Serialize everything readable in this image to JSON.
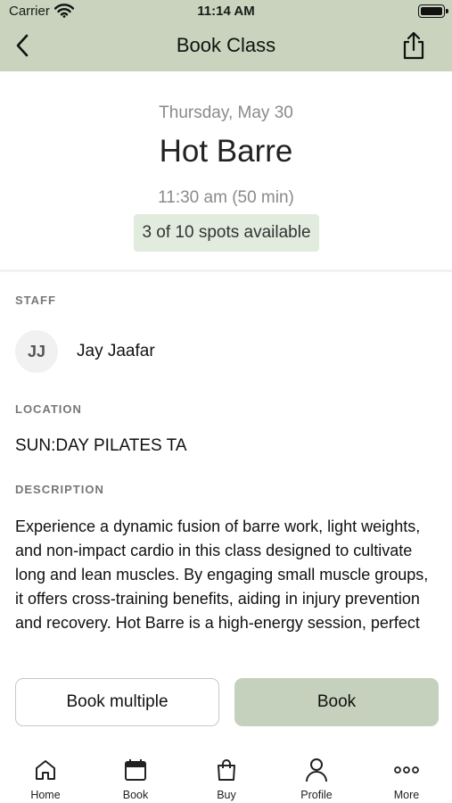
{
  "status_bar": {
    "carrier": "Carrier",
    "time": "11:14 AM"
  },
  "nav": {
    "title": "Book Class"
  },
  "class": {
    "date": "Thursday, May 30",
    "name": "Hot Barre",
    "time": "11:30 am (50 min)",
    "spots": "3 of 10 spots available"
  },
  "staff": {
    "label": "STAFF",
    "initials": "JJ",
    "name": "Jay Jaafar"
  },
  "location": {
    "label": "LOCATION",
    "value": "SUN:DAY PILATES TA"
  },
  "description": {
    "label": "DESCRIPTION",
    "text": "Experience a dynamic fusion of barre work, light weights, and non-impact cardio in this class designed to cultivate long and lean muscles. By engaging small muscle groups, it offers cross-training benefits, aiding in injury prevention and recovery. Hot Barre is a high-energy session, perfect"
  },
  "actions": {
    "book_multiple": "Book multiple",
    "book": "Book"
  },
  "tabs": [
    {
      "label": "Home",
      "icon": "home-icon"
    },
    {
      "label": "Book",
      "icon": "calendar-icon"
    },
    {
      "label": "Buy",
      "icon": "shopping-bag-icon"
    },
    {
      "label": "Profile",
      "icon": "person-icon"
    },
    {
      "label": "More",
      "icon": "more-dots-icon"
    }
  ],
  "colors": {
    "header_bg": "#c9d3bd",
    "book_button": "#c6d1bd",
    "spots_badge": "#e1ecdf"
  }
}
